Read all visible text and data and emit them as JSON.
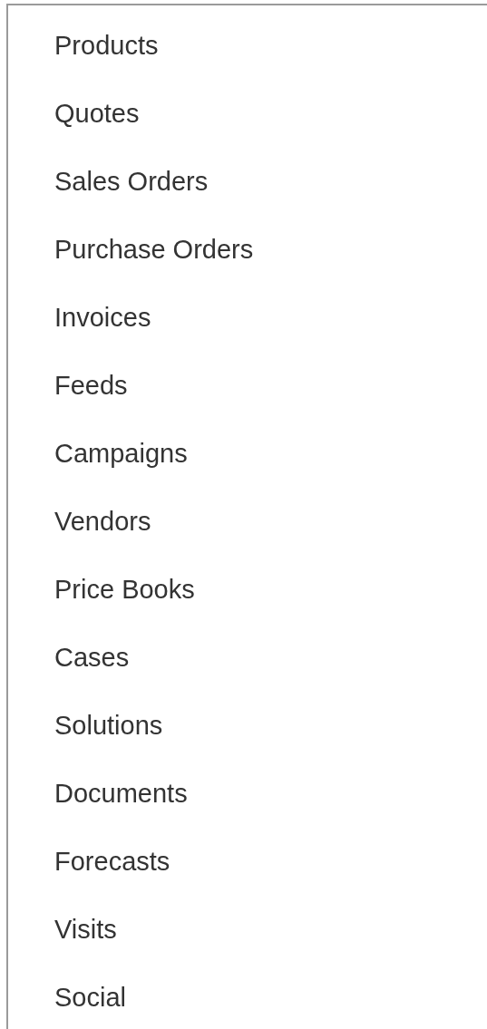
{
  "menu": {
    "items": [
      {
        "label": "Products"
      },
      {
        "label": "Quotes"
      },
      {
        "label": "Sales Orders"
      },
      {
        "label": "Purchase Orders"
      },
      {
        "label": "Invoices"
      },
      {
        "label": "Feeds"
      },
      {
        "label": "Campaigns"
      },
      {
        "label": "Vendors"
      },
      {
        "label": "Price Books"
      },
      {
        "label": "Cases"
      },
      {
        "label": "Solutions"
      },
      {
        "label": "Documents"
      },
      {
        "label": "Forecasts"
      },
      {
        "label": "Visits"
      },
      {
        "label": "Social"
      }
    ]
  }
}
